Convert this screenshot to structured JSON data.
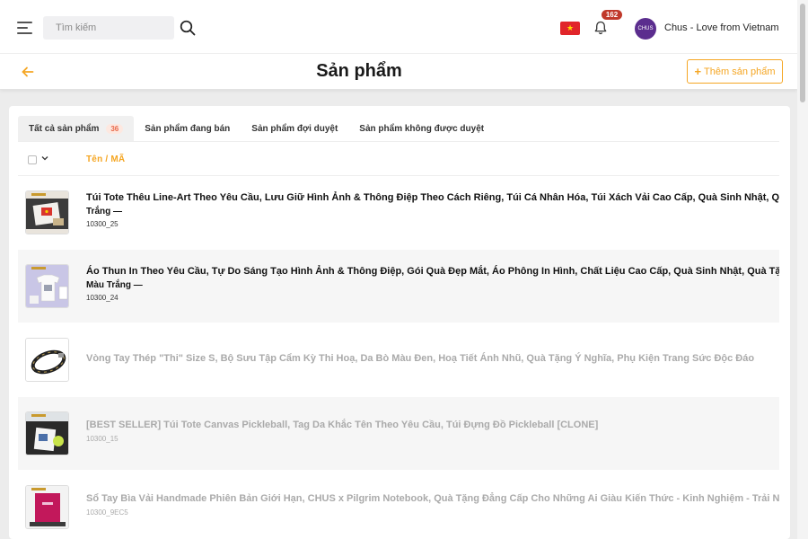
{
  "topbar": {
    "menu_icon": "hamburger-menu-icon",
    "search_placeholder": "Tìm kiếm",
    "search_icon": "search-icon",
    "flag_icon": "vietnam-flag-icon",
    "bell_icon": "bell-icon",
    "notification_count": "162",
    "avatar_text": "CHUS",
    "shop_name": "Chus - Love from Vietnam"
  },
  "header": {
    "back_icon": "arrow-left-icon",
    "title": "Sản phẩm",
    "add_button_plus": "+",
    "add_button_label": "Thêm sản phẩm"
  },
  "tabs": [
    {
      "label": "Tất cả sản phẩm",
      "count": "36",
      "active": true
    },
    {
      "label": "Sản phẩm đang bán"
    },
    {
      "label": "Sản phẩm đợi duyệt"
    },
    {
      "label": "Sản phẩm không được duyệt"
    }
  ],
  "table": {
    "column_label": "Tên  /  MÃ",
    "rows": [
      {
        "name": "Túi Tote Thêu Line-Art Theo Yêu Cầu, Lưu Giữ Hình Ảnh & Thông Điệp Theo Cách Riêng, Túi Cá Nhân Hóa, Túi Xách Vải Cao Cấp, Quà Sinh Nhật, Quà Tặng Cá Nhân",
        "variant": "Trắng —",
        "sku": "10300_25"
      },
      {
        "name": "Áo Thun In Theo Yêu Cầu, Tự Do Sáng Tạo Hình Ảnh & Thông Điệp, Gói Quà Đẹp Mắt, Áo Phông In Hình, Chất Liệu Cao Cấp, Quà Sinh Nhật, Quà Tặng Cá Nhân",
        "variant": "Màu Trắng —",
        "sku": "10300_24"
      },
      {
        "name": "Vòng Tay Thép \"Thi\" Size S, Bộ Sưu Tập Cẩm Kỳ Thi Hoạ, Da Bò Màu Đen, Hoạ Tiết Ánh Nhũ, Quà Tặng Ý Nghĩa, Phụ Kiện Trang Sức Độc Đáo",
        "variant": "",
        "sku": ""
      },
      {
        "name": "[BEST SELLER] Túi Tote Canvas Pickleball, Tag Da Khắc Tên Theo Yêu Cầu, Túi Đựng Đồ Pickleball [CLONE]",
        "variant": "",
        "sku": "10300_15"
      },
      {
        "name": "Sổ Tay Bìa Vải Handmade Phiên Bản Giới Hạn, CHUS x Pilgrim Notebook, Quà Tặng Đẳng Cấp Cho Những Ai Giàu Kiến Thức - Kinh Nghiệm - Trải Nghiệm, Quà Sinh Nhật",
        "variant": "",
        "sku": "10300_9EC5"
      }
    ]
  }
}
